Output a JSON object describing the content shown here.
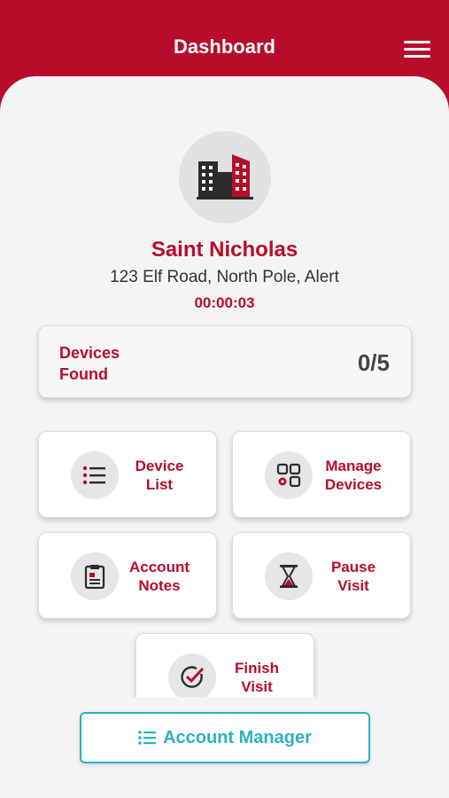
{
  "header": {
    "title": "Dashboard",
    "menu_icon": "hamburger-menu-icon"
  },
  "colors": {
    "brand": "#b80c2b",
    "accent": "#2bb1bf",
    "background": "#f4f4f4"
  },
  "site": {
    "icon": "building-icon",
    "name": "Saint Nicholas",
    "address": "123 Elf Road, North Pole, Alert",
    "timer": "00:00:03"
  },
  "devices": {
    "label": "Devices Found",
    "count": "0/5"
  },
  "tiles": [
    {
      "label": "Device List",
      "icon": "list-icon"
    },
    {
      "label": "Manage Devices",
      "icon": "apps-gear-icon"
    },
    {
      "label": "Account Notes",
      "icon": "clipboard-icon"
    },
    {
      "label": "Pause Visit",
      "icon": "hourglass-icon"
    },
    {
      "label": "Finish Visit",
      "icon": "checkmark-circle-icon"
    }
  ],
  "footer": {
    "account_manager_label": "Account Manager",
    "icon": "list-icon"
  }
}
